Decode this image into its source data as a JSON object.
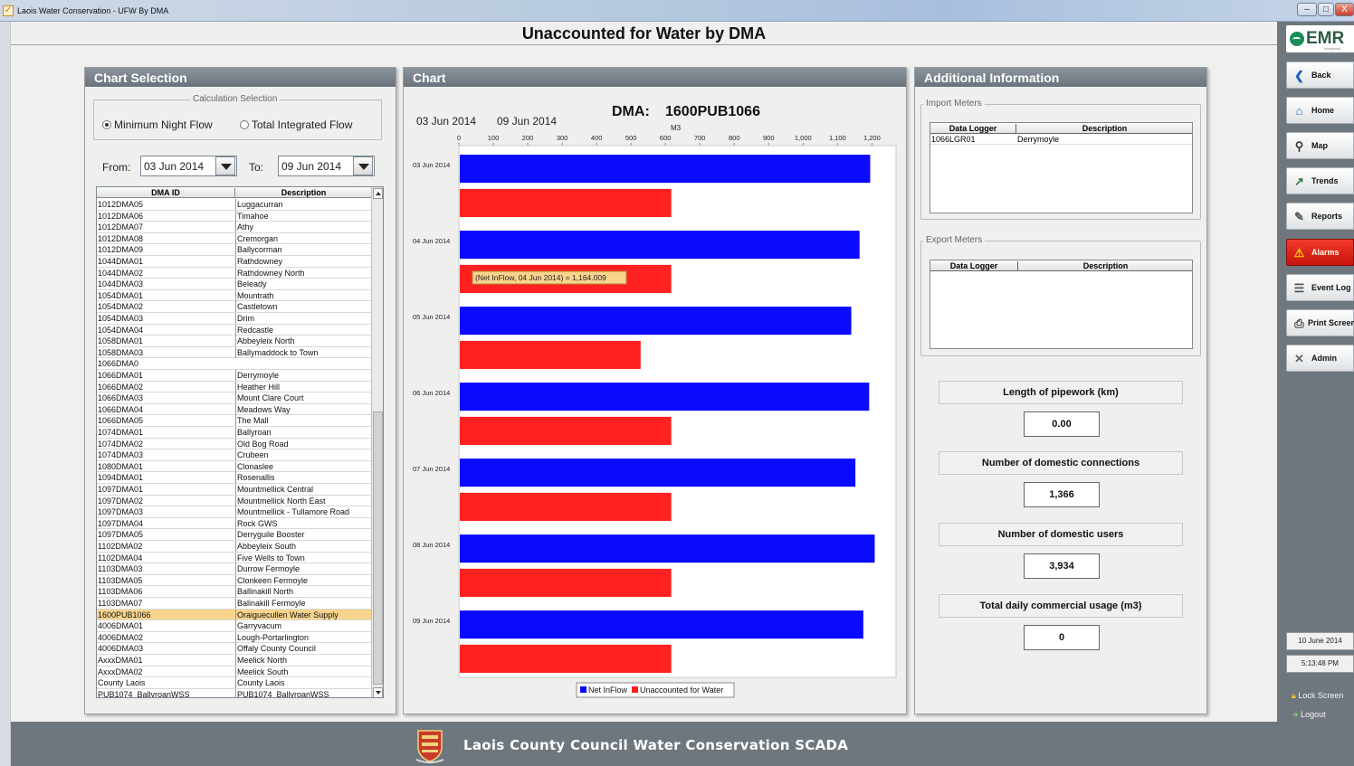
{
  "window": {
    "title": "Laois Water Conservation - UFW By DMA",
    "minimize": "–",
    "maximize": "□",
    "close": "X"
  },
  "page": {
    "title": "Unaccounted for Water by DMA"
  },
  "selection_panel": {
    "header": "Chart Selection",
    "calculation_legend": "Calculation Selection",
    "options": [
      {
        "label": "Minimum Night Flow",
        "selected": true
      },
      {
        "label": "Total Integrated Flow",
        "selected": false
      }
    ],
    "from_label": "From:",
    "from_value": "03 Jun 2014",
    "to_label": "To:",
    "to_value": "09 Jun 2014",
    "table": {
      "columns": [
        "DMA ID",
        "Description"
      ],
      "rows": [
        [
          "1012DMA05",
          "Luggacurran"
        ],
        [
          "1012DMA06",
          "Timahoe"
        ],
        [
          "1012DMA07",
          "Athy"
        ],
        [
          "1012DMA08",
          "Cremorgan"
        ],
        [
          "1012DMA09",
          "Ballycorman"
        ],
        [
          "1044DMA01",
          "Rathdowney"
        ],
        [
          "1044DMA02",
          "Rathdowney North"
        ],
        [
          "1044DMA03",
          "Beleady"
        ],
        [
          "1054DMA01",
          "Mountrath"
        ],
        [
          "1054DMA02",
          "Castletown"
        ],
        [
          "1054DMA03",
          "Drim"
        ],
        [
          "1054DMA04",
          "Redcastle"
        ],
        [
          "1058DMA01",
          "Abbeyleix North"
        ],
        [
          "1058DMA03",
          "Ballymaddock to Town"
        ],
        [
          "1066DMA0",
          ""
        ],
        [
          "1066DMA01",
          "Derrymoyle"
        ],
        [
          "1066DMA02",
          "Heather Hill"
        ],
        [
          "1066DMA03",
          "Mount Clare Court"
        ],
        [
          "1066DMA04",
          "Meadows Way"
        ],
        [
          "1066DMA05",
          "The Mall"
        ],
        [
          "1074DMA01",
          "Ballyroan"
        ],
        [
          "1074DMA02",
          "Old Bog Road"
        ],
        [
          "1074DMA03",
          "Crubeen"
        ],
        [
          "1080DMA01",
          "Clonaslee"
        ],
        [
          "1094DMA01",
          "Rosenallis"
        ],
        [
          "1097DMA01",
          "Mountmellick Central"
        ],
        [
          "1097DMA02",
          "Mountmellick North East"
        ],
        [
          "1097DMA03",
          "Mountmellick - Tullamore Road"
        ],
        [
          "1097DMA04",
          "Rock GWS"
        ],
        [
          "1097DMA05",
          "Derryguile Booster"
        ],
        [
          "1102DMA02",
          "Abbeyleix South"
        ],
        [
          "1102DMA04",
          "Five Wells to Town"
        ],
        [
          "1103DMA03",
          "Durrow Fermoyle"
        ],
        [
          "1103DMA05",
          "Clonkeen Fermoyle"
        ],
        [
          "1103DMA06",
          "Ballinakill North"
        ],
        [
          "1103DMA07",
          "Balinakill Fermoyle"
        ],
        [
          "1600PUB1066",
          "Oraiguecullen Water Supply"
        ],
        [
          "4006DMA01",
          "Garryvacum"
        ],
        [
          "4006DMA02",
          "Lough-Portarlington"
        ],
        [
          "4006DMA03",
          "Offaly County Council"
        ],
        [
          "AxxxDMA01",
          "Meelick North"
        ],
        [
          "AxxxDMA02",
          "Meelick South"
        ],
        [
          "County Laois",
          "County Laois"
        ],
        [
          "PUB1074_BallyroanWSS",
          "PUB1074_BallyroanWSS"
        ]
      ],
      "selected_index": 36
    }
  },
  "chart_panel": {
    "header": "Chart",
    "dma_label": "DMA:",
    "dma_value": "1600PUB1066",
    "from_date": "03 Jun 2014",
    "to_date": "09 Jun 2014",
    "tooltip": "(Net InFlow, 04 Jun 2014) = 1,164.009"
  },
  "chart_data": {
    "type": "bar",
    "orientation": "horizontal",
    "title": "DMA: 1600PUB1066",
    "xlabel": "M3",
    "ylabel": "",
    "xlim": [
      0,
      1270
    ],
    "xticks": [
      0,
      100,
      200,
      300,
      400,
      500,
      600,
      700,
      800,
      900,
      1000,
      1100,
      1200
    ],
    "xtick_labels": [
      "0",
      "100",
      "200",
      "300",
      "400",
      "500",
      "600",
      "700",
      "800",
      "900",
      "1,000",
      "1,100",
      "1,200"
    ],
    "categories": [
      "03 Jun 2014",
      "04 Jun 2014",
      "05 Jun 2014",
      "06 Jun 2014",
      "07 Jun 2014",
      "08 Jun 2014",
      "09 Jun 2014"
    ],
    "series": [
      {
        "name": "Net InFlow",
        "color": "#0a0aff",
        "values": [
          1195,
          1164,
          1140,
          1192,
          1152,
          1208,
          1175
        ]
      },
      {
        "name": "Unaccounted for Water",
        "color": "#ff2020",
        "values": [
          617,
          617,
          528,
          617,
          617,
          617,
          617
        ]
      }
    ],
    "legend_position": "bottom-center",
    "grid": false
  },
  "info_panel": {
    "header": "Additional Information",
    "import_legend": "Import Meters",
    "export_legend": "Export Meters",
    "meter_columns": [
      "Data Logger",
      "Description"
    ],
    "import_rows": [
      [
        "1066LGR01",
        "Derrymoyle"
      ]
    ],
    "stats": [
      {
        "label": "Length of pipework (km)",
        "value": "0.00"
      },
      {
        "label": "Number of domestic connections",
        "value": "1,366"
      },
      {
        "label": "Number of domestic users",
        "value": "3,934"
      },
      {
        "label": "Total daily commercial usage (m3)",
        "value": "0"
      }
    ]
  },
  "nav": {
    "logo": "EMR",
    "logo_sub": "Integrated solutions",
    "buttons": [
      {
        "label": "Back",
        "icon": "back-arrow-icon"
      },
      {
        "label": "Home",
        "icon": "home-icon"
      },
      {
        "label": "Map",
        "icon": "map-icon"
      },
      {
        "label": "Trends",
        "icon": "trends-icon"
      },
      {
        "label": "Reports",
        "icon": "reports-icon"
      },
      {
        "label": "Alarms",
        "icon": "alarm-icon",
        "color": "#e0281a"
      },
      {
        "label": "Event Log",
        "icon": "event-log-icon"
      },
      {
        "label": "Print Screen",
        "icon": "printer-icon"
      },
      {
        "label": "Admin",
        "icon": "admin-icon"
      }
    ],
    "date": "10 June 2014",
    "time": "5:13:48 PM",
    "lock_screen": "Lock Screen",
    "logout": "Logout"
  },
  "footer": {
    "text": "Laois County Council Water Conservation SCADA"
  }
}
